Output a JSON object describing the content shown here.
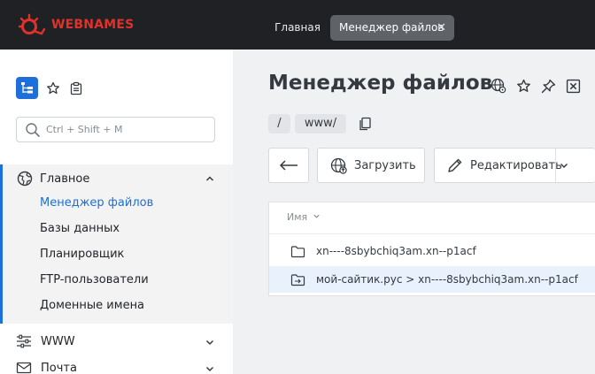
{
  "header": {
    "brand": "WEBNAMES",
    "tabs": [
      {
        "label": "Главная"
      },
      {
        "label": "Менеджер файлов",
        "active": true
      }
    ],
    "close_symbol": "✕"
  },
  "sidebar": {
    "search": {
      "placeholder": "Ctrl + Shift + M",
      "value": ""
    },
    "main_group": {
      "label": "Главное",
      "items": [
        {
          "label": "Менеджер файлов",
          "active": true
        },
        {
          "label": "Базы данных"
        },
        {
          "label": "Планировщик"
        },
        {
          "label": "FTP-пользователи"
        },
        {
          "label": "Доменные имена"
        }
      ]
    },
    "groups": [
      {
        "label": "WWW"
      },
      {
        "label": "Почта"
      }
    ]
  },
  "main": {
    "title": "Менеджер файлов",
    "breadcrumb": [
      "/",
      "www/"
    ],
    "toolbar": {
      "upload_label": "Загрузить",
      "edit_label": "Редактировать"
    },
    "table": {
      "column_name": "Имя",
      "rows": [
        {
          "type": "folder",
          "name": "xn----8sbybchiq3am.xn--p1acf"
        },
        {
          "type": "symlink",
          "name": "мой-сайтик.рус > xn----8sbybchiq3am.xn--p1acf"
        }
      ]
    }
  },
  "colors": {
    "accent": "#1e6fd9",
    "brand": "#e0312b",
    "topbar": "#202124",
    "row_highlight": "#e8f1fc"
  }
}
